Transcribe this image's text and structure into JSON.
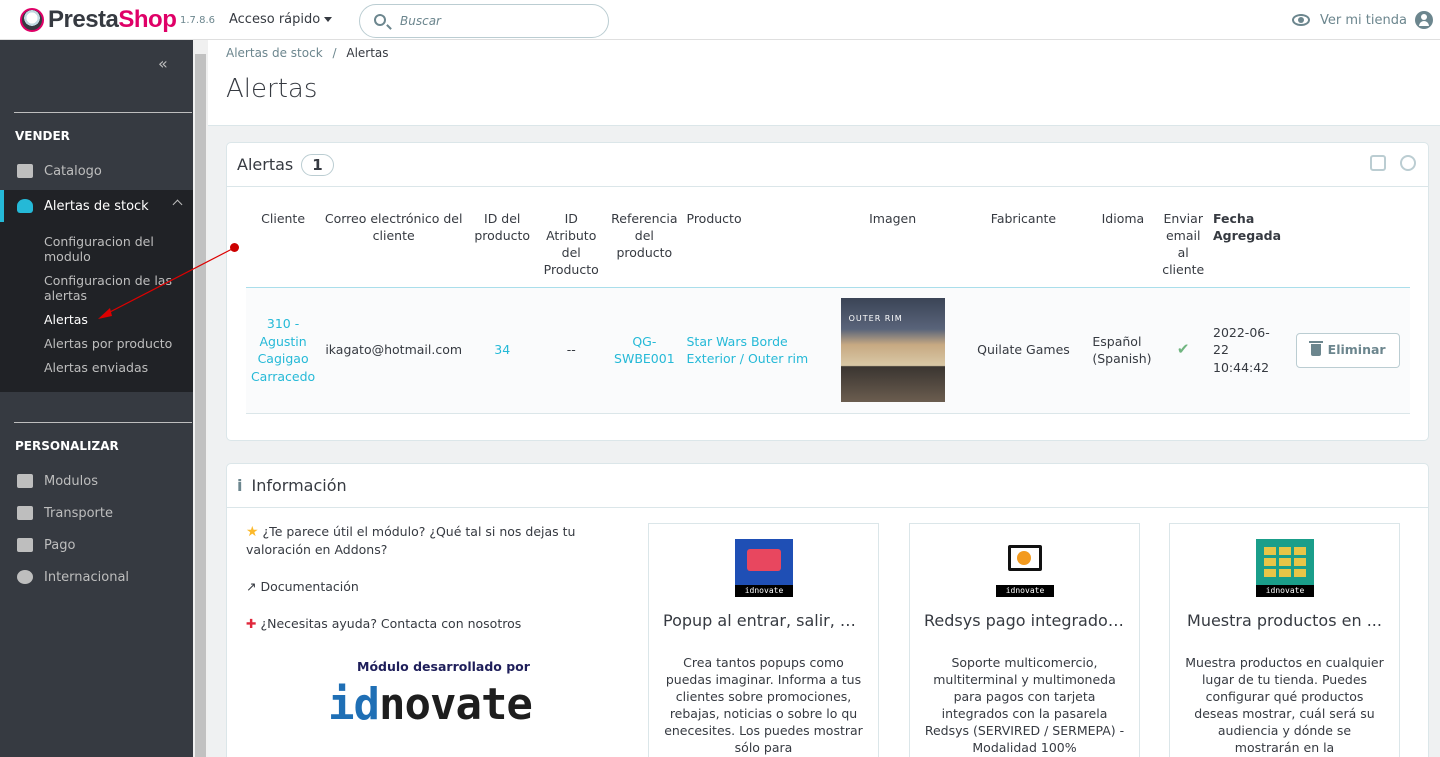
{
  "header": {
    "logo_prefix": "Presta",
    "logo_suffix": "Shop",
    "version": "1.7.8.6",
    "quick_access": "Acceso rápido",
    "search_placeholder": "Buscar",
    "view_store": "Ver mi tienda"
  },
  "sidebar": {
    "collapse_glyph": "«",
    "section_sell": "VENDER",
    "section_customize": "PERSONALIZAR",
    "items": [
      {
        "label": "Catalogo",
        "icon": "store-icon"
      },
      {
        "label": "Alertas de stock",
        "icon": "bell-icon"
      },
      {
        "label": "Modulos",
        "icon": "puzzle-icon"
      },
      {
        "label": "Transporte",
        "icon": "truck-icon"
      },
      {
        "label": "Pago",
        "icon": "credit-card-icon"
      },
      {
        "label": "Internacional",
        "icon": "globe-icon"
      }
    ],
    "submenu": [
      "Configuracion del modulo",
      "Configuracion de las alertas",
      "Alertas",
      "Alertas por producto",
      "Alertas enviadas"
    ]
  },
  "breadcrumb": {
    "parent": "Alertas de stock",
    "sep": "/",
    "current": "Alertas"
  },
  "page_title": "Alertas",
  "alerts_panel": {
    "title": "Alertas",
    "count": "1",
    "columns": [
      "Cliente",
      "Correo electrónico del cliente",
      "ID del producto",
      "ID Atributo del Producto",
      "Referencia del producto",
      "Producto",
      "Imagen",
      "Fabricante",
      "Idioma",
      "Enviar email al cliente",
      "Fecha Agregada"
    ],
    "row": {
      "client": "310 - Agustin Cagigao Carracedo",
      "email": "ikagato@hotmail.com",
      "product_id": "34",
      "attribute_id": "--",
      "reference": "QG-SWBE001",
      "product": "Star Wars Borde Exterior / Outer rim",
      "image_text": "OUTER RIM",
      "manufacturer": "Quilate Games",
      "language": "Español (Spanish)",
      "send_email": "✔",
      "date": "2022-06-22 10:44:42",
      "delete_label": "Eliminar"
    }
  },
  "info_panel": {
    "title": "Información",
    "rate_text": "¿Te parece útil el módulo? ¿Qué tal si nos dejas tu valoración en Addons?",
    "docs_text": "Documentación",
    "help_text": "¿Necesitas ayuda? Contacta con nosotros",
    "developed_by": "Módulo desarrollado por",
    "brand_id": "id",
    "brand_rest": "novate",
    "cards": [
      {
        "title": "Popup al entrar, salir, a...",
        "desc": "Crea tantos popups como puedas imaginar. Informa a tus clientes sobre promociones, rebajas, noticias o sobre lo qu enecesites. Los puedes mostrar sólo para",
        "tag": "idnovate",
        "icon": "popup-icon",
        "color": "#1f4fb5"
      },
      {
        "title": "Redsys pago integrado ...",
        "desc": "Soporte multicomercio, multiterminal y multimoneda para pagos con tarjeta integrados con la pasarela Redsys (SERVIRED / SERMEPA) - Modalidad 100%",
        "tag": "idnovate",
        "icon": "monitor-icon",
        "color": "#ffffff"
      },
      {
        "title": "Muestra productos en ...",
        "desc": "Muestra productos en cualquier lugar de tu tienda. Puedes configurar qué productos deseas mostrar, cuál será su audiencia y dónde se mostrarán en la",
        "tag": "idnovate",
        "icon": "grid-icon",
        "color": "#1a9e8a"
      }
    ]
  },
  "colors": {
    "accent": "#25b9d7",
    "brand": "#df0067",
    "sidebar": "#363a41"
  }
}
